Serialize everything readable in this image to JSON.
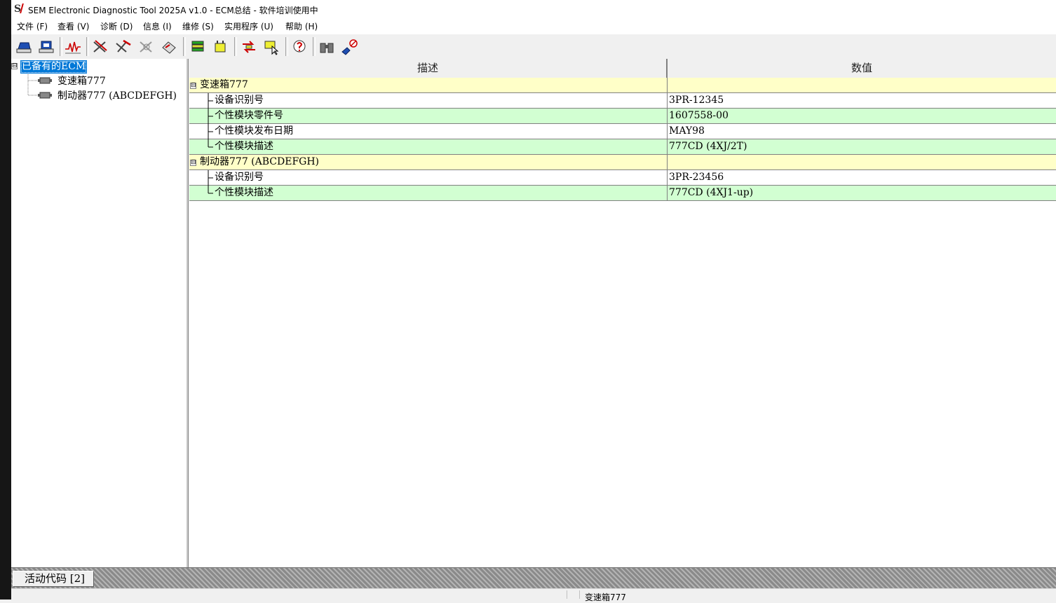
{
  "window": {
    "title": "SEM Electronic Diagnostic Tool 2025A v1.0 - ECM总结 - 软件培训使用中",
    "logo_letter": "S"
  },
  "menu": [
    {
      "label": "文件 (F)"
    },
    {
      "label": "查看 (V)"
    },
    {
      "label": "诊断 (D)"
    },
    {
      "label": "信息 (I)"
    },
    {
      "label": "维修 (S)"
    },
    {
      "label": "实用程序 (U)"
    },
    {
      "label": "帮助 (H)"
    }
  ],
  "toolbar": [
    {
      "icon": "ecm-summary-icon"
    },
    {
      "icon": "ecm-connect-icon"
    },
    {
      "icon": "status-waveform-icon"
    },
    {
      "icon": "active-diagnostics-icon"
    },
    {
      "icon": "logged-diagnostics-icon"
    },
    {
      "icon": "clear-events-icon"
    },
    {
      "icon": "configuration-icon"
    },
    {
      "icon": "calibration-icon"
    },
    {
      "icon": "service-test-icon"
    },
    {
      "icon": "data-transfer-icon"
    },
    {
      "icon": "data-select-icon"
    },
    {
      "icon": "help-icon"
    },
    {
      "icon": "binoculars-icon"
    },
    {
      "icon": "disconnect-icon"
    }
  ],
  "tree": {
    "root": "已备有的ECM",
    "children": [
      {
        "label": "变速箱777"
      },
      {
        "label": "制动器777 (ABCDEFGH)"
      }
    ]
  },
  "grid": {
    "headers": {
      "description": "描述",
      "value": "数值"
    },
    "rows": [
      {
        "desc": "变速箱777",
        "value": "",
        "kind": "group"
      },
      {
        "desc": "设备识别号",
        "value": "3PR-12345",
        "kind": "plain"
      },
      {
        "desc": "个性模块零件号",
        "value": "1607558-00",
        "kind": "alt"
      },
      {
        "desc": "个性模块发布日期",
        "value": "MAY98",
        "kind": "plain"
      },
      {
        "desc": "个性模块描述",
        "value": "777CD (4XJ/2T)",
        "kind": "alt"
      },
      {
        "desc": "制动器777 (ABCDEFGH)",
        "value": "",
        "kind": "group"
      },
      {
        "desc": "设备识别号",
        "value": "3PR-23456",
        "kind": "plain"
      },
      {
        "desc": "个性模块描述",
        "value": "777CD (4XJ1-up)",
        "kind": "alt"
      }
    ]
  },
  "bottom": {
    "active_codes": "活动代码 [2]",
    "status_text": "变速箱777"
  },
  "colors": {
    "group_row": "#ffffc8",
    "alt_row": "#d2ffd2",
    "selection": "#0078d7"
  }
}
